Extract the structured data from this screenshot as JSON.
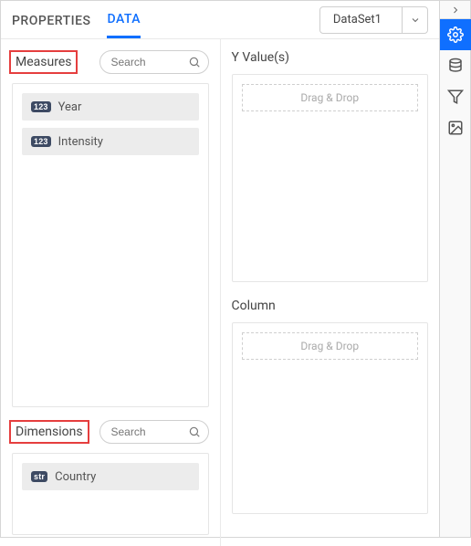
{
  "tabs": {
    "properties": "PROPERTIES",
    "data": "DATA"
  },
  "dataset": {
    "name": "DataSet1"
  },
  "measures": {
    "label": "Measures",
    "search_ph": "Search",
    "items": [
      {
        "badge": "123",
        "name": "Year"
      },
      {
        "badge": "123",
        "name": "Intensity"
      }
    ]
  },
  "dimensions": {
    "label": "Dimensions",
    "search_ph": "Search",
    "items": [
      {
        "badge": "str",
        "name": "Country"
      }
    ]
  },
  "assign": {
    "yvalues": {
      "label": "Y Value(s)",
      "placeholder": "Drag & Drop"
    },
    "column": {
      "label": "Column",
      "placeholder": "Drag & Drop"
    }
  }
}
